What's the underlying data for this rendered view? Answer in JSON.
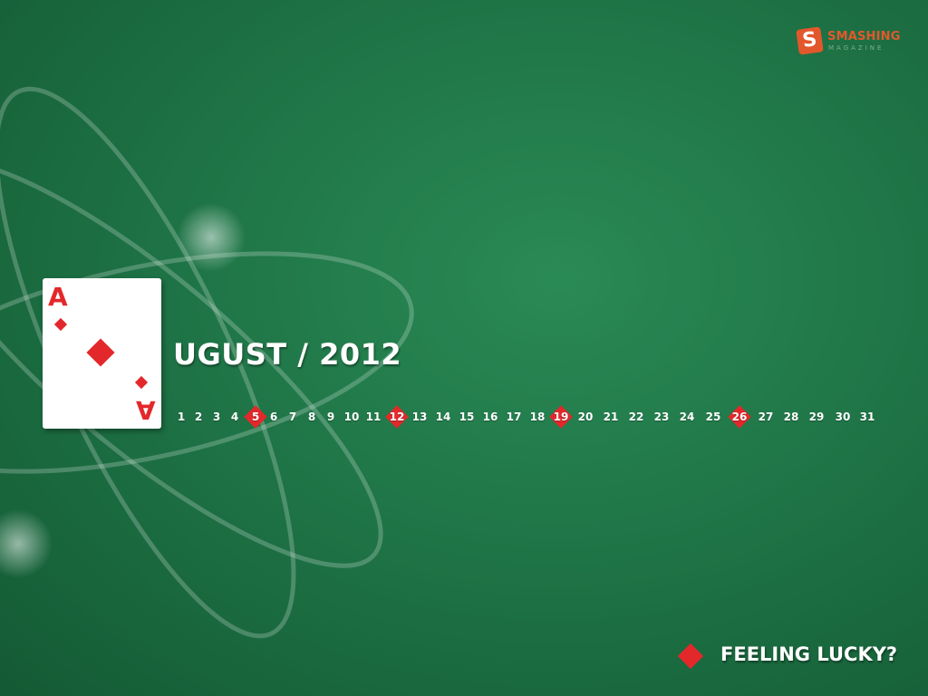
{
  "brand": {
    "mark": "S",
    "name": "SMASHING",
    "sub": "MAGAZINE"
  },
  "card": {
    "rank": "A",
    "suit": "diamond-icon"
  },
  "calendar": {
    "month_label": "UGUST / 2012",
    "days": [
      "1",
      "2",
      "3",
      "4",
      "5",
      "6",
      "7",
      "8",
      "9",
      "10",
      "11",
      "12",
      "13",
      "14",
      "15",
      "16",
      "17",
      "18",
      "19",
      "20",
      "21",
      "22",
      "23",
      "24",
      "25",
      "26",
      "27",
      "28",
      "29",
      "30",
      "31"
    ],
    "highlighted_days": [
      "5",
      "12",
      "19",
      "26"
    ]
  },
  "tagline": "FEELING LUCKY?",
  "colors": {
    "background": "#1f7547",
    "accent_red": "#e3282b",
    "brand_orange": "#e3572c"
  }
}
